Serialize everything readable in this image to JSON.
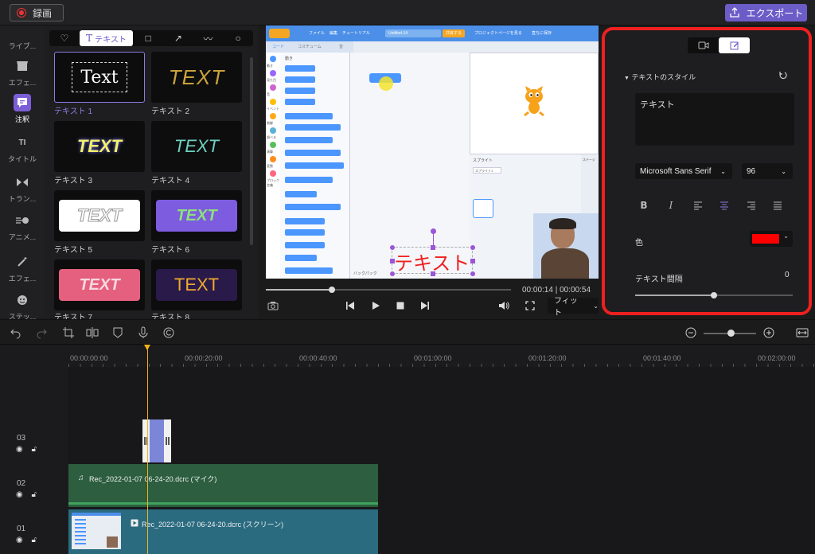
{
  "topbar": {
    "record_label": "録画",
    "export_label": "エクスポート"
  },
  "rail": [
    {
      "label": "ライブ...",
      "icon": "folder-icon"
    },
    {
      "label": "エフェ...",
      "icon": "store-icon"
    },
    {
      "label": "注釈",
      "icon": "annotation-icon",
      "active": true
    },
    {
      "label": "タイトル",
      "icon": "title-icon"
    },
    {
      "label": "トラン...",
      "icon": "transition-icon"
    },
    {
      "label": "アニメ...",
      "icon": "animation-icon"
    },
    {
      "label": "エフェ...",
      "icon": "magic-wand-icon"
    },
    {
      "label": "ステッ...",
      "icon": "sticker-icon"
    }
  ],
  "library": {
    "tabs": [
      "♡",
      "テキスト",
      "□",
      "↗",
      "〰",
      "○"
    ],
    "active_tab": "テキスト",
    "items": [
      {
        "label": "テキスト 1",
        "preview": "Text"
      },
      {
        "label": "テキスト 2",
        "preview": "TEXT"
      },
      {
        "label": "テキスト 3",
        "preview": "TEXT"
      },
      {
        "label": "テキスト 4",
        "preview": "TEXT"
      },
      {
        "label": "テキスト 5",
        "preview": "TEXT"
      },
      {
        "label": "テキスト 6",
        "preview": "TEXT"
      },
      {
        "label": "テキスト 7",
        "preview": "TEXT"
      },
      {
        "label": "テキスト 8",
        "preview": "TEXT"
      }
    ]
  },
  "preview": {
    "overlay_text": "テキスト",
    "scratch_menu": [
      "ファイル",
      "編集",
      "チュートリアル"
    ],
    "scratch_project": "Untitled-14",
    "scratch_share": "共有する",
    "scratch_project_page": "プロジェクトページを見る",
    "scratch_save": "直ちに保存",
    "scratch_tabs": [
      "コード",
      "コスチューム",
      "音"
    ],
    "scratch_categories": [
      "動き",
      "見た目",
      "音",
      "イベント",
      "制御",
      "調べる",
      "演算",
      "変数",
      "ブロック定義"
    ],
    "scratch_section": "動き",
    "scratch_sprite_label": "スプライト",
    "scratch_sprite_name": "スプライト1",
    "scratch_stage": "ステージ",
    "scratch_backpack": "バックパック"
  },
  "controls": {
    "current_time": "00:00:14",
    "total_time": "00:00:54",
    "fit_label": "フィット",
    "progress": 0.27
  },
  "properties": {
    "section_title": "テキストのスタイル",
    "text_value": "テキスト",
    "font": "Microsoft Sans Serif",
    "font_size": "96",
    "color_label": "色",
    "color_value": "#ff0000",
    "spacing_label": "テキスト間隔",
    "spacing_value": "0",
    "spacing_progress": 0.5
  },
  "timeline": {
    "ruler": [
      "00:00:00:00",
      "00:00:20:00",
      "00:00:40:00",
      "00:01:00:00",
      "00:01:20:00",
      "00:01:40:00",
      "00:02:00:00"
    ],
    "tracks": [
      {
        "num": "03"
      },
      {
        "num": "02",
        "clip": "Rec_2022-01-07 06-24-20.dcrc (マイク)"
      },
      {
        "num": "01",
        "clip": "Rec_2022-01-07 06-24-20.dcrc (スクリーン)"
      }
    ]
  },
  "colors": {
    "accent": "#6c5cc7",
    "highlight_border": "#ee2020",
    "playhead": "#f2b21a"
  }
}
